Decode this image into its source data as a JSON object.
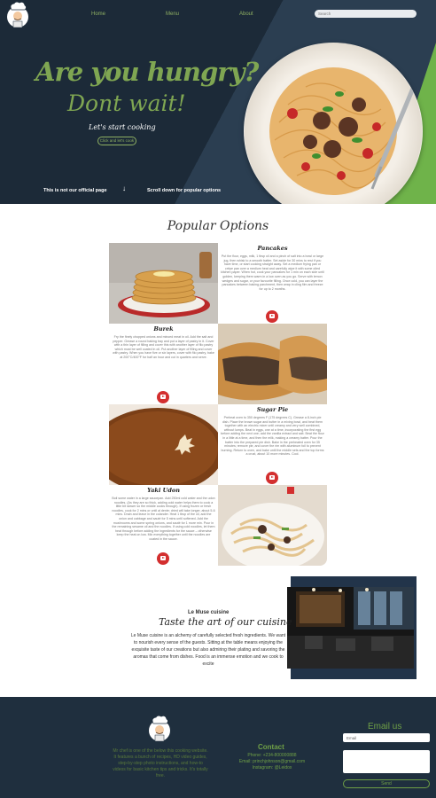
{
  "nav": {
    "home": "Home",
    "menu": "Menu",
    "about": "About"
  },
  "search": {
    "placeholder": "Search"
  },
  "hero": {
    "title1": "Are you hungry?",
    "title2": "Dont wait!",
    "subtitle": "Let's start cooking",
    "button": "Click and let's cook",
    "footer_left": "This is not our official page",
    "arrow": "🡓",
    "footer_right": "Scroll down for popular options"
  },
  "popular": {
    "title": "Popular Options",
    "items": [
      {
        "name": "Pancakes",
        "text": "Put the flour, eggs, milk, 1 tbsp oil and a pinch of salt into a bowl or large jug, then whisk to a smooth batter. Set aside for 30 mins to rest if you have time, or start cooking straight away. Set a medium frying pan or crêpe pan over a medium heat and carefully wipe it with some oiled kitchen paper. When hot, cook your pancakes for 1 min on each side until golden, keeping them warm in a low oven as you go. Serve with lemon wedges and sugar, or your favourite filling. Once cold, you can layer the pancakes between baking parchment, then wrap in cling film and freeze for up to 2 months."
      },
      {
        "name": "Burek",
        "text": "Fry the finely chopped onions and minced meat in oil. Add the salt and pepper. Grease a round baking tray and put a layer of pastry in it. Cover with a thin layer of filling and cover this with another layer of filo pastry which must be well coated in oil. Put another layer of filling and cover with pastry. When you have five or six layers, cover with filo pastry, bake at 200°C/400°F for half an hour and cut in quarters and serve."
      },
      {
        "name": "Sugar Pie",
        "text": "Preheat oven to 350 degrees F (175 degrees C). Grease a 8-inch pie dish. Place the brown sugar and butter in a mixing bowl, and beat them together with an electric mixer until creamy and very well combined, without lumps. Beat in eggs, one at a time, incorporating the first egg before adding the next one; add the vanilla extract and salt. Beat the flour in a little at a time, and then the milk, making a creamy batter. Pour the batter into the prepared pie dish. Bake in the preheated oven for 35 minutes; remove pie, and cover the rim with aluminum foil to prevent burning. Return to oven, and bake until the middle sets and the top forms a crust, about 10 more minutes. Cool."
      },
      {
        "name": "Yaki Udon",
        "text": "Boil some water in a large saucepan. Add 250ml cold water and the udon noodles. (As they are so thick, adding cold water helps them to cook a little bit slower so the middle cooks through). If using frozen or fresh noodles, cook for 2 mins or until al dente; dried will take longer, about 5-6 mins. Drain and leave in the colander. Heat 1 tbsp of the oil, add the onion and cabbage and sauté for 5 mins until softened. Add the mushrooms and some spring onions, and sauté for 1 more min. Pour in the remaining sesame oil and the noodles. If using cold noodles, let them heat through before adding the ingredients for the sauce – otherwise keep the heat on low. Mix everything together until the noodles are coated in the sauce."
      }
    ]
  },
  "about": {
    "small": "Le Muse cuisine",
    "heading": "Taste the art of our cuisine",
    "text": "Le Muse cuisine is an alchemy of carefully selected fresh ingredients. We want to nourish every sense of the guests. Sitting at the table means enjoying the exquisite taste of our creations but also admiring their plating and savoring the aromas that come from dishes. Food is an immense emotion and we cook to excite"
  },
  "footer": {
    "about": "Mr chef is one of the below this cooking website. It features a bunch of recipes, HD video guides, step-by-step photo instructions, and how-to videos for basic kitchen tips and tricks. It's totally free.",
    "contact_title": "Contact",
    "phone": "Phone: +234-800000888",
    "email": "Email: princhjohnson@gmail.com",
    "instagram": "Instagram: @Leidox",
    "email_title": "Email us",
    "email_placeholder": "Email",
    "send": "Send"
  },
  "colors": {
    "navy": "#1f2f3e",
    "green": "#7fa652",
    "bright_green": "#6fb34a",
    "youtube": "#d32f2f"
  }
}
